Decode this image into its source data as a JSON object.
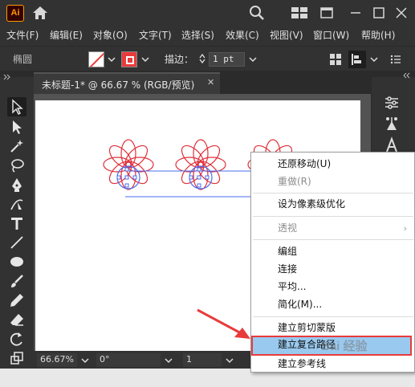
{
  "app": {
    "logo_text": "Ai"
  },
  "menu": [
    "文件(F)",
    "编辑(E)",
    "对象(O)",
    "文字(T)",
    "选择(S)",
    "效果(C)",
    "视图(V)",
    "窗口(W)",
    "帮助(H)"
  ],
  "control_bar": {
    "shape_label": "椭圆",
    "stroke_label": "描边：",
    "stroke_value": "1 pt"
  },
  "document_tab": {
    "title": "未标题-1* @ 66.67 % (RGB/预览)",
    "close": "✕"
  },
  "status_bar": {
    "zoom": "66.67%",
    "rotation": "0°",
    "artboard": "1"
  },
  "context_menu": {
    "items": [
      {
        "label": "还原移动(U)",
        "disabled": false
      },
      {
        "label": "重做(R)",
        "disabled": true
      },
      {
        "label": "设为像素级优化",
        "disabled": false
      },
      {
        "label": "透视",
        "disabled": true,
        "submenu": true
      },
      {
        "label": "编组",
        "disabled": false
      },
      {
        "label": "连接",
        "disabled": false
      },
      {
        "label": "平均...",
        "disabled": false
      },
      {
        "label": "简化(M)...",
        "disabled": false
      },
      {
        "label": "建立剪切蒙版",
        "disabled": false
      },
      {
        "label": "建立复合路径",
        "disabled": false,
        "highlighted": true
      },
      {
        "label": "建立参考线",
        "disabled": false
      }
    ],
    "submenu_arrow": "›"
  },
  "colors": {
    "accent_red": "#e83b3b",
    "highlight_blue": "#99c9ef",
    "flower_red": "#e0303a",
    "selection_blue": "#4a6cf0"
  },
  "watermark": "Bai 经验"
}
